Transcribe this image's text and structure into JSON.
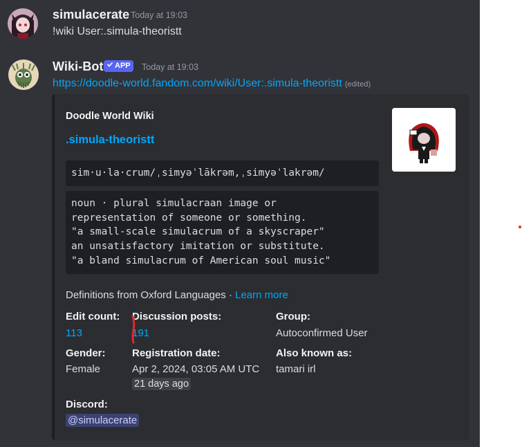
{
  "messages": [
    {
      "author": "simulacerate",
      "timestamp": "Today at 19:03",
      "text": "!wiki User:.simula-theoristt"
    },
    {
      "author": "Wiki-Bot",
      "badge": "APP",
      "timestamp": "Today at 19:03",
      "link": "https://doodle-world.fandom.com/wiki/User:.simula-theoristt",
      "edited_label": "(edited)"
    }
  ],
  "embed": {
    "provider": "Doodle World Wiki",
    "title": ".simula-theoristt",
    "pronunciation": "sim·u·la·crum/ˌsimyəˈlākrəm,ˌsimyəˈlakrəm/",
    "definition_lines": [
      "noun · plural simulacraan image or",
      "representation of someone or something.",
      "\"a small-scale simulacrum of a skyscraper\"",
      "an unsatisfactory imitation or substitute.",
      "\"a bland simulacrum of American soul music\""
    ],
    "definitions_source": "Definitions from Oxford Languages ·",
    "learn_more": "Learn more",
    "fields": {
      "edit_count": {
        "name": "Edit count:",
        "value": "113"
      },
      "discussion_posts": {
        "name": "Discussion posts:",
        "value": "191"
      },
      "group": {
        "name": "Group:",
        "value": "Autoconfirmed User"
      },
      "gender": {
        "name": "Gender:",
        "value": "Female"
      },
      "registration_date": {
        "name": "Registration date:",
        "value": "Apr 2, 2024, 03:05 AM UTC",
        "relative": "21 days ago"
      },
      "also_known_as": {
        "name": "Also known as:",
        "value": "tamari irl"
      },
      "discord": {
        "name": "Discord:",
        "value": "@simulacerate"
      }
    }
  },
  "colors": {
    "background": "#313338",
    "embed_background": "#2b2d31",
    "link": "#00a8fc",
    "app_badge": "#5865f2",
    "annotation_red": "#e8262c"
  },
  "icons": {
    "badge_check": "checkmark-icon"
  }
}
